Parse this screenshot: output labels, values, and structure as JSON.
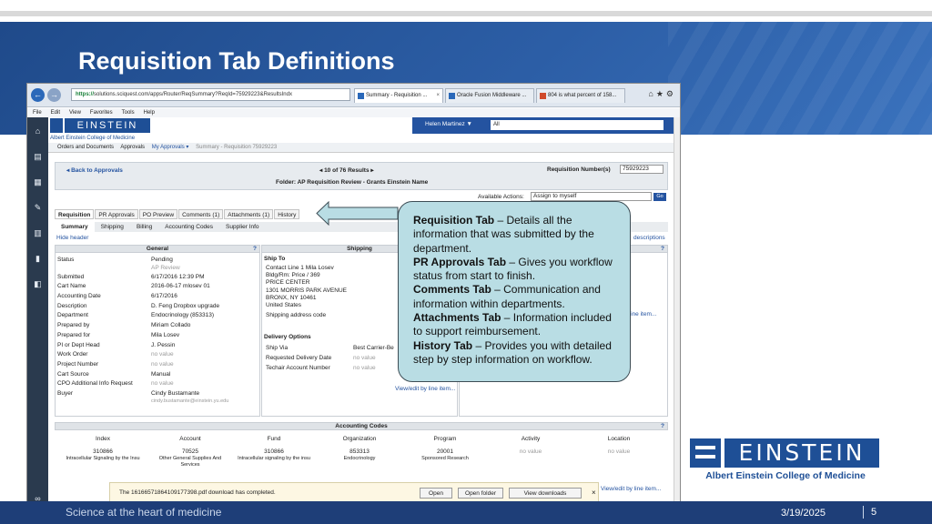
{
  "slide": {
    "title": "Requisition Tab Definitions",
    "footer_left": "Science at the heart of medicine",
    "footer_date": "3/19/2025",
    "footer_page": "5",
    "logo_word": "EINSTEIN",
    "logo_sub": "Albert Einstein College of Medicine"
  },
  "browser": {
    "url_secure": "https://",
    "url_rest": "solutions.sciquest.com/apps/Router/ReqSummary?ReqId=75929223&ResultsIndx",
    "tabs": [
      {
        "label": "Summary - Requisition ..."
      },
      {
        "label": "Oracle Fusion Middleware ..."
      },
      {
        "label": "804 is what percent of 158..."
      }
    ],
    "menu": [
      "File",
      "Edit",
      "View",
      "Favorites",
      "Tools",
      "Help"
    ]
  },
  "app": {
    "logo_word": "EINSTEIN",
    "logo_sub": "Albert Einstein College of Medicine",
    "user": "Helen Martinez ▼",
    "scope": "All",
    "breadcrumbs": [
      "Orders and Documents",
      "Approvals",
      "My Approvals ▾",
      "Summary - Requisition 75929223"
    ],
    "back_link": "◂ Back to Approvals",
    "results": "◂  10 of 76 Results  ▸",
    "folder": "Folder: AP Requisition Review - Grants Einstein Name",
    "req_number_label": "Requisition Number(s)",
    "req_number_value": "75929223",
    "available_actions_label": "Available Actions:",
    "available_actions_value": "Assign to myself",
    "go": "Go",
    "tabs_main": [
      "Requisition",
      "PR Approvals",
      "PO Preview",
      "Comments (1)",
      "Attachments (1)",
      "History"
    ],
    "tabs_sub": [
      "Summary",
      "Shipping",
      "Billing",
      "Accounting Codes",
      "Supplier Info"
    ],
    "hide_header": "Hide header",
    "descriptions": "descriptions",
    "general_title": "General",
    "general_labels": [
      "Status",
      "",
      "Submitted",
      "Cart Name",
      "Accounting Date",
      "Description",
      "Department",
      "Prepared by",
      "Prepared for",
      "PI or Dept Head",
      "Work Order",
      "Project Number",
      "Cart Source",
      "CPO Additional Info Request",
      "Buyer",
      ""
    ],
    "general_values": [
      "Pending",
      "AP Review",
      "6/17/2016 12:39 PM",
      "2016-06-17 mlosev 01",
      "6/17/2016",
      "D. Feng Dropbox upgrade",
      "Endocrinology (853313)",
      "Miriam Collado",
      "Mila Losev",
      "J. Pessin",
      "no value",
      "no value",
      "Manual",
      "no value",
      "Cindy Bustamante",
      "cindy.bustamante@einstein.yu.edu"
    ],
    "shipping_title": "Shipping",
    "ship_to_label": "Ship To",
    "ship_to_lines": [
      "Contact Line 1 Mila Losev",
      "Bldg/Rm: Price / 369",
      "PRICE CENTER",
      "1301 MORRIS PARK AVENUE",
      "BRONX, NY 10461",
      "United States",
      "Shipping address code"
    ],
    "delivery_label": "Delivery Options",
    "delivery_rows": [
      {
        "label": "Ship Via",
        "value": "Best Carrier-Be"
      },
      {
        "label": "Requested Delivery Date",
        "value": "no value"
      },
      {
        "label": "Techair Account Number",
        "value": "no value"
      }
    ],
    "view_edit": "View/edit by line item...",
    "view_edit_short": "by line item...",
    "accounting_title": "Accounting Codes",
    "acct_headers": [
      "Index",
      "Account",
      "Fund",
      "Organization",
      "Program",
      "Activity",
      "Location"
    ],
    "acct_values": [
      [
        "310866",
        "Intracellular Signaling by the Insu"
      ],
      [
        "70525",
        "Other General Supplies And Services"
      ],
      [
        "310866",
        "Intracellular signaling by the insu"
      ],
      [
        "853313",
        "Endocrinology"
      ],
      [
        "20001",
        "Sponsored Research"
      ],
      [
        "no value",
        ""
      ],
      [
        "no value",
        ""
      ]
    ],
    "download_text": "The 16166571864109177398.pdf download has completed.",
    "download_buttons": [
      "Open",
      "Open folder",
      "View downloads"
    ]
  },
  "callout": {
    "requisition_tab": "Requisition Tab",
    "requisition_text": " – Details all the information that was submitted by the department.",
    "pr_tab": "PR Approvals Tab",
    "pr_text": " – Gives you workflow status from start to finish.",
    "comments_tab": "Comments Tab",
    "comments_text": " – Communication and information within departments.",
    "attachments_tab": "Attachments Tab",
    "attachments_text": " – Information included to support reimbursement.",
    "history_tab": "History Tab",
    "history_text": " – Provides you with detailed step by step information on workflow."
  }
}
